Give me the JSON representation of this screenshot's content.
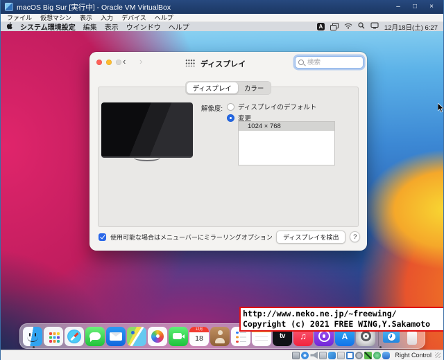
{
  "vbox": {
    "title": "macOS Big Sur [実行中] - Oracle VM VirtualBox",
    "menu": [
      "ファイル",
      "仮想マシン",
      "表示",
      "入力",
      "デバイス",
      "ヘルプ"
    ],
    "controls": {
      "minimize": "–",
      "maximize": "□",
      "close": "×"
    },
    "statusbar": {
      "host_key": "Right Control",
      "icons": [
        "hard-disk",
        "optical-drive",
        "audio",
        "network",
        "usb",
        "shared-folders",
        "display",
        "recording",
        "virtualization",
        "features",
        "mouse-integration"
      ]
    }
  },
  "macos": {
    "menubar": {
      "items": [
        "システム環境設定",
        "編集",
        "表示",
        "ウインドウ",
        "ヘルプ"
      ],
      "input_badge": "A",
      "clock": "12月18日(土) 6:27"
    },
    "prefs": {
      "title": "ディスプレイ",
      "nav_back": "‹",
      "nav_forward": "›",
      "search_placeholder": "検索",
      "tabs": [
        "ディスプレイ",
        "カラー"
      ],
      "resolution_label": "解像度:",
      "radio_default": "ディスプレイのデフォルト",
      "radio_change": "変更",
      "resolutions": [
        "1024 × 768"
      ],
      "mirroring_label": "使用可能な場合はメニューバーにミラーリングオプションを表示",
      "detect_button": "ディスプレイを検出",
      "help_button": "?"
    },
    "dock": {
      "apps": [
        "Finder",
        "Launchpad",
        "Safari",
        "Messages",
        "Mail",
        "Maps",
        "Photos",
        "FaceTime",
        "Calendar",
        "Contacts",
        "Reminders",
        "Notes",
        "TV",
        "Music",
        "Podcasts",
        "App Store",
        "System Preferences",
        "Downloads",
        "Trash"
      ],
      "calendar": {
        "month": "12月",
        "day": "18"
      },
      "tv_glyph": "tv",
      "music_glyph": "♫",
      "appstore_glyph": "A"
    }
  },
  "overlay": {
    "line1": "http://www.neko.ne.jp/~freewing/",
    "line2": "Copyright (c) 2021 FREE WING,Y.Sakamoto"
  },
  "colors": {
    "vb_titlebar": "#1d3a6b",
    "accent_blue": "#2567e2",
    "overlay_border": "#e01212",
    "wallpaper_pink": "#d4226b",
    "wallpaper_orange": "#f39c23"
  }
}
